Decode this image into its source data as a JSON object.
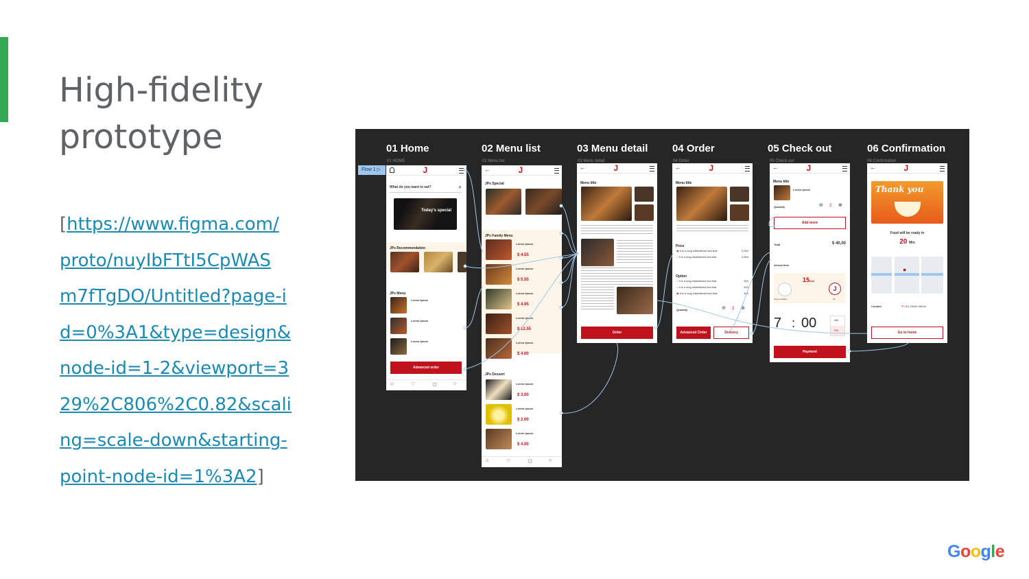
{
  "slide": {
    "title_lines": [
      "High-fidelity",
      "prototype"
    ],
    "link": {
      "open": "[",
      "close": "]",
      "lines": [
        "https://www.figma.com/",
        "proto/nuyIbFTtI5CpWAS",
        "m7fTgDO/Untitled?page-i",
        "d=0%3A1&type=design&",
        "node-id=1-2&viewport=3",
        "29%2C806%2C0.82&scali",
        "ng=scale-down&starting-",
        "point-node-id=1%3A2"
      ]
    },
    "brand": {
      "letters": [
        "G",
        "o",
        "o",
        "g",
        "l",
        "e"
      ],
      "colors": [
        "#4285f4",
        "#ea4335",
        "#fbbc05",
        "#4285f4",
        "#34a853",
        "#ea4335"
      ]
    }
  },
  "prototype": {
    "flow_tag": "Flow 1",
    "frames": [
      {
        "title": "01 Home",
        "sub": "01 HOME"
      },
      {
        "title": "02 Menu list",
        "sub": "02 Menu list"
      },
      {
        "title": "03 Menu detail",
        "sub": "03 Menu detail"
      },
      {
        "title": "04 Order",
        "sub": "04 Order"
      },
      {
        "title": "05 Check out",
        "sub": "05 Check out"
      },
      {
        "title": "06 Confirmation",
        "sub": "06 Confirmation"
      }
    ],
    "home": {
      "search_placeholder": "What do you want to eat?",
      "banner": "Today's special",
      "section_recommendation": "JPs Recommendation",
      "section_menu": "JPs Menu",
      "item_label": "Lorem Ipsum",
      "button": "Advanced order"
    },
    "menu_list": {
      "section_special": "JPs Special",
      "section_family": "JPs Family Menu",
      "section_dessert": "JPs Dessert",
      "item_label": "Lorem Ipsum",
      "prices": [
        "$ 4.55",
        "$ 5.55",
        "$ 4.05",
        "$ 12.55",
        "$ 4.00",
        "$ 3.00",
        "$ 2.00",
        "$ 4.00"
      ]
    },
    "menu_detail": {
      "title": "Menu title",
      "button": "Order"
    },
    "order": {
      "title": "Menu title",
      "price_label": "Price",
      "option_label": "Option",
      "quantity_label": "Quantity",
      "quantity": "2",
      "price_values": [
        "2,000",
        "4,000"
      ],
      "option_values": [
        "500",
        "400",
        "400"
      ],
      "option_text": "It is a long established fact that",
      "btn_advanced": "Advanced Order",
      "btn_delivery": "Delivery"
    },
    "checkout": {
      "title": "Menu title",
      "item": "Lorem Ipsum",
      "quantity_label": "Quantity",
      "quantity": "2",
      "add_more": "Add more",
      "total_label": "Total",
      "total": "$ 40,00",
      "arrival_label": "Arrival time",
      "eta": "15",
      "eta_unit": "min",
      "your_location": "You're location",
      "jp_label": "JP",
      "time_hour": "7",
      "time_min": "00",
      "am": "AM",
      "pm": "PM",
      "button": "Payment"
    },
    "confirmation": {
      "thank_you": "Thank you",
      "ready_text": "Food will be ready in",
      "minutes": "20",
      "minutes_unit": "Min",
      "contact_label": "Contact",
      "phone": "010-29040-48540",
      "button": "Go to home"
    }
  }
}
